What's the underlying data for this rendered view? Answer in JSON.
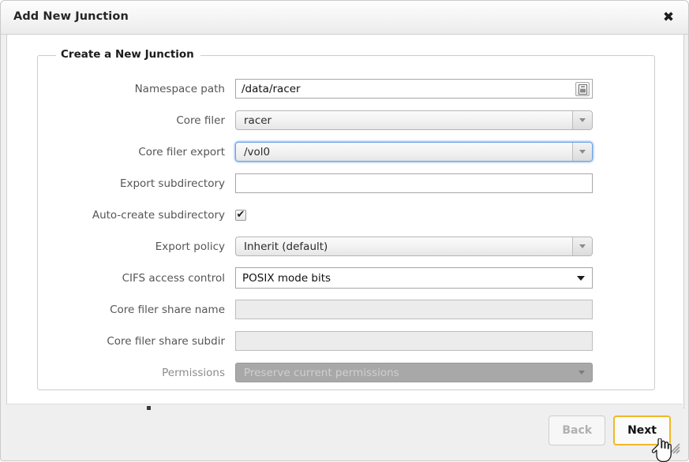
{
  "window": {
    "title": "Add New Junction",
    "close_icon": "close-icon",
    "close_glyph": "✖"
  },
  "form": {
    "legend": "Create a New Junction",
    "rows": [
      {
        "label": "Namespace path",
        "control": "text",
        "value": "/data/racer",
        "placeholder": "",
        "disabled": false,
        "picker_icon": "directory-picker-icon"
      },
      {
        "label": "Core filer",
        "control": "cselect",
        "value": "racer",
        "focused": false,
        "disabled": false
      },
      {
        "label": "Core filer export",
        "control": "cselect",
        "value": "/vol0",
        "focused": true,
        "disabled": false
      },
      {
        "label": "Export subdirectory",
        "control": "text",
        "value": "",
        "placeholder": "",
        "disabled": false
      },
      {
        "label": "Auto-create subdirectory",
        "control": "checkbox",
        "checked": true,
        "check_glyph": "✔"
      },
      {
        "label": "Export policy",
        "control": "cselect",
        "value": "Inherit (default)",
        "focused": false,
        "disabled": false
      },
      {
        "label": "CIFS access control",
        "control": "nselect",
        "value": "POSIX mode bits",
        "disabled": false
      },
      {
        "label": "Core filer share name",
        "control": "text",
        "value": "",
        "placeholder": "",
        "disabled": true
      },
      {
        "label": "Core filer share subdir",
        "control": "text",
        "value": "",
        "placeholder": "",
        "disabled": true
      },
      {
        "label": "Permissions",
        "control": "dselect",
        "value": "Preserve current permissions",
        "disabled": true
      }
    ]
  },
  "footer": {
    "back_label": "Back",
    "next_label": "Next",
    "resize_grip_icon": "resize-grip-icon"
  },
  "colors": {
    "focus_ring": "#6aa2e8",
    "primary_button_border": "#f0b726",
    "titlebar_bg": "#f6f6f6",
    "footer_bg": "#efefef",
    "disabled_text": "#8c8c8c"
  }
}
